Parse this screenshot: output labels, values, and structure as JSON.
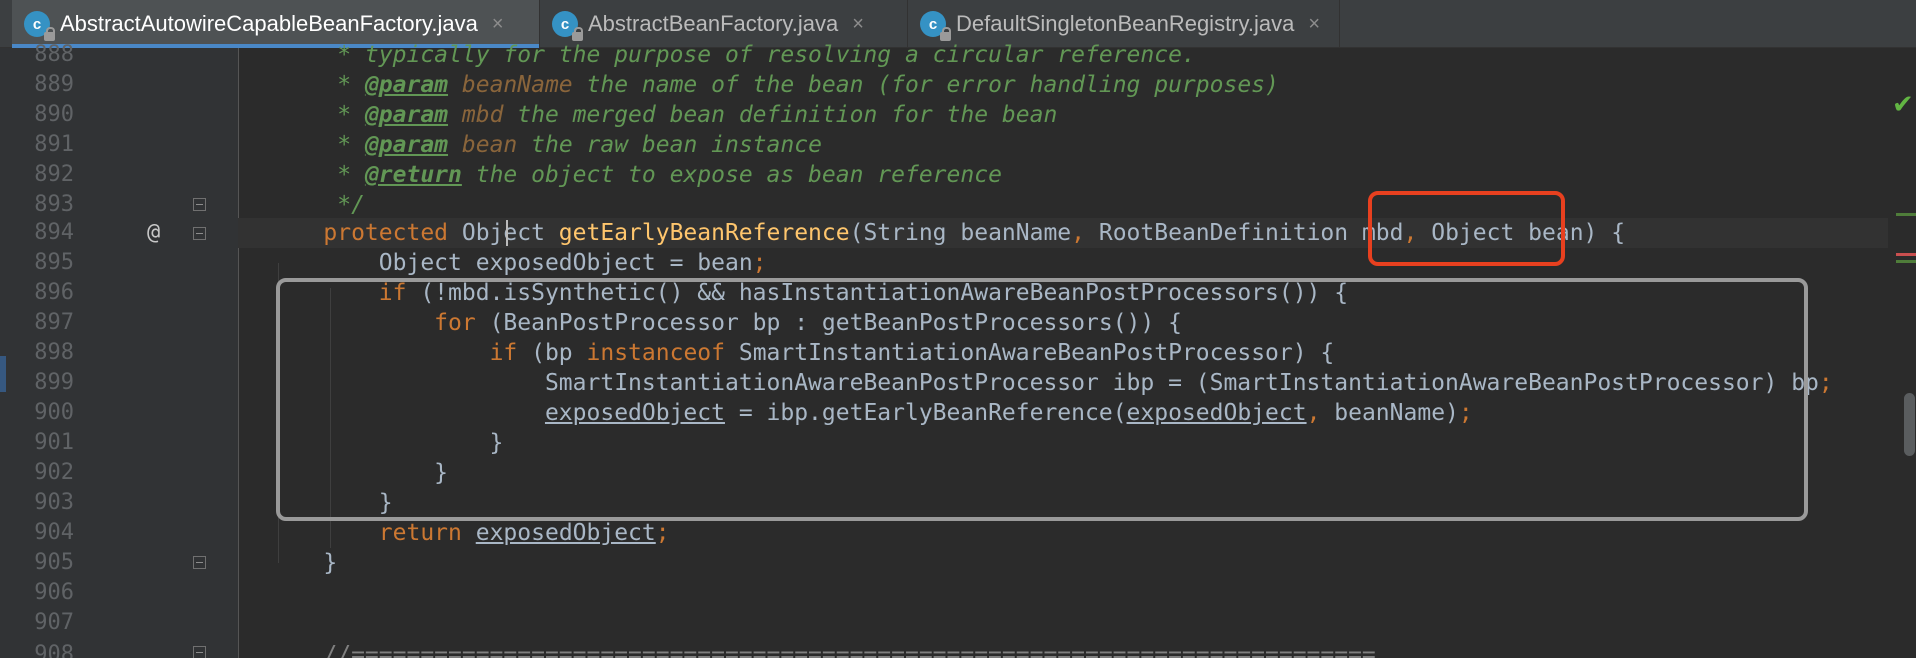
{
  "tabs": [
    {
      "label": "AbstractAutowireCapableBeanFactory.java",
      "icon": "class-icon",
      "icon_letter": "c",
      "active": true
    },
    {
      "label": "AbstractBeanFactory.java",
      "icon": "class-icon",
      "icon_letter": "c",
      "active": false
    },
    {
      "label": "DefaultSingletonBeanRegistry.java",
      "icon": "class-icon",
      "icon_letter": "c",
      "active": false
    }
  ],
  "close_glyph": "×",
  "gutter": {
    "line_numbers": [
      "888",
      "889",
      "890",
      "891",
      "892",
      "893",
      "894",
      "895",
      "896",
      "897",
      "898",
      "899",
      "900",
      "901",
      "902",
      "903",
      "904",
      "905",
      "906",
      "907",
      "908"
    ],
    "override_marker": "@"
  },
  "code": {
    "l888": {
      "text": "     * typically for the purpose of resolving a circular reference."
    },
    "l889": {
      "star": "     * ",
      "tag": "@param",
      "name": " beanName",
      "rest": " the name of the bean (for error handling purposes)"
    },
    "l890": {
      "star": "     * ",
      "tag": "@param",
      "name": " mbd",
      "rest": " the merged bean definition for the bean"
    },
    "l891": {
      "star": "     * ",
      "tag": "@param",
      "name": " bean",
      "rest": " the raw bean instance"
    },
    "l892": {
      "star": "     * ",
      "tag": "@return",
      "rest": " the object to expose as bean reference"
    },
    "l893": {
      "text": "     */"
    },
    "l894": {
      "indent": "    ",
      "kw": "protected",
      "type": " Object ",
      "fn": "getEarlyBeanReference",
      "p1": "(String beanName",
      "c1": ",",
      "p2": " RootBeanDefinition mbd",
      "c2": ",",
      "p3": " Object bean) {"
    },
    "l895": {
      "indent": "        ",
      "t1": "Object ",
      "var": "exposedObject",
      "t2": " = bean",
      "semi": ";"
    },
    "l896": {
      "indent": "        ",
      "kw": "if",
      "rest": " (!mbd.isSynthetic() && hasInstantiationAwareBeanPostProcessors()) {"
    },
    "l897": {
      "indent": "            ",
      "kw": "for",
      "rest": " (BeanPostProcessor bp : getBeanPostProcessors()) {"
    },
    "l898": {
      "indent": "                ",
      "kw": "if",
      "t1": " (bp ",
      "kw2": "instanceof",
      "rest": " SmartInstantiationAwareBeanPostProcessor) {"
    },
    "l899": {
      "indent": "                    ",
      "rest": "SmartInstantiationAwareBeanPostProcessor ibp = (SmartInstantiationAwareBeanPostProcessor) bp",
      "semi": ";"
    },
    "l900": {
      "indent": "                    ",
      "var": "exposedObject",
      "t1": " = ibp.getEarlyBeanReference(",
      "var2": "exposedObject",
      "c1": ",",
      "t2": " beanName)",
      "semi": ";"
    },
    "l901": {
      "text": "                }"
    },
    "l902": {
      "text": "            }"
    },
    "l903": {
      "text": "        }"
    },
    "l904": {
      "indent": "        ",
      "kw": "return",
      "t1": " ",
      "var": "exposedObject",
      "semi": ";"
    },
    "l905": {
      "text": "    }"
    },
    "l906": {
      "text": ""
    },
    "l907": {
      "text": ""
    },
    "l908": {
      "text": "    //=========================================================================="
    }
  },
  "colors": {
    "keyword": "#cc7832",
    "method": "#ffc66d",
    "doc_comment": "#629755",
    "plain": "#a9b7c6",
    "highlight_box": "#e8401f",
    "region_box": "#9a9a9a"
  }
}
